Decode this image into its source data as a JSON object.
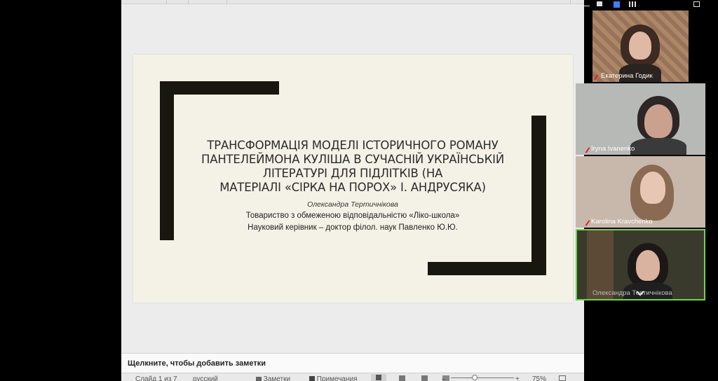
{
  "slide": {
    "title_lines": [
      "ТРАНСФОРМАЦІЯ МОДЕЛІ ІСТОРИЧНОГО РОМАНУ",
      "ПАНТЕЛЕЙМОНА КУЛІША В СУЧАСНІЙ УКРАЇНСЬКІЙ",
      "ЛІТЕРАТУРІ ДЛЯ ПІДЛІТКІВ (НА",
      "МАТЕРІАЛІ «СІРКА НА ПОРОХ» І. АНДРУСЯКА)"
    ],
    "author": "Олександра Тертичнікова",
    "org_lines": [
      "Товариство з обмеженою відповідальністю «Ліко-школа»",
      "Науковий керівник – доктор філол. наук Павленко Ю.Ю."
    ]
  },
  "notes": {
    "placeholder": "Щелкните, чтобы добавить заметки"
  },
  "status": {
    "slide_info": "Слайд 1 из 7",
    "language": "русский",
    "notes_label": "Заметки",
    "comments_label": "Примечания",
    "zoom": "75%",
    "zoom_minus": "–",
    "zoom_plus": "+"
  },
  "participants": [
    {
      "name": "Екатерина Годик",
      "muted": true
    },
    {
      "name": "Iryna Ivanenko",
      "muted": true
    },
    {
      "name": "Karolina Kravchenko",
      "muted": true
    },
    {
      "name": "Олександра Тертичнікова",
      "muted": false
    }
  ],
  "colors": {
    "slide_bg": "#f4f2e6",
    "slide_bars": "#17170f",
    "active_speaker_border": "#6fd34a",
    "mute_red": "#e02424"
  }
}
